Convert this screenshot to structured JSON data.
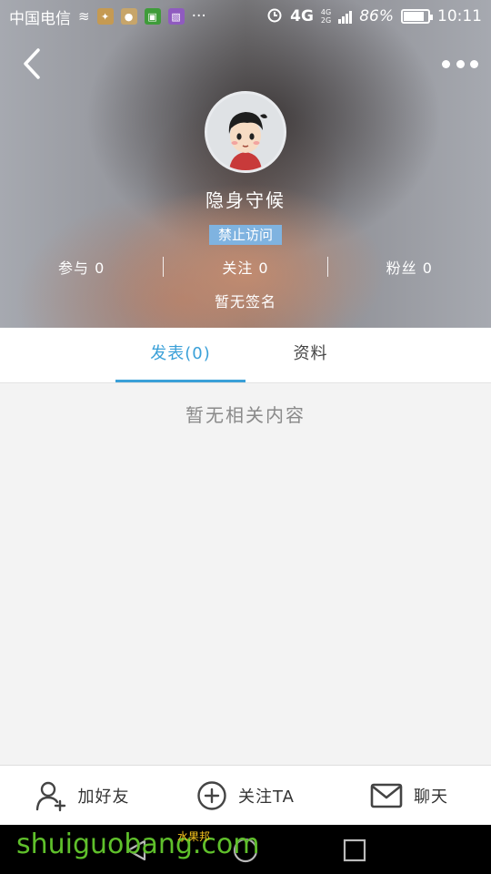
{
  "status_bar": {
    "carrier": "中国电信",
    "battery": "86%",
    "battery_level": 0.86,
    "time": "10:11",
    "network": "4G",
    "network2": "4G",
    "network3": "2G",
    "overflow": "···"
  },
  "profile": {
    "nickname": "隐身守候",
    "ban_label": "禁止访问",
    "signature": "暂无签名"
  },
  "stats": [
    {
      "label": "参与 0"
    },
    {
      "label": "关注 0"
    },
    {
      "label": "粉丝 0"
    }
  ],
  "tabs": [
    {
      "label": "发表(0)",
      "active": true
    },
    {
      "label": "资料",
      "active": false
    }
  ],
  "content": {
    "empty_text": "暂无相关内容"
  },
  "actions": [
    {
      "label": "加好友",
      "icon": "add-user-icon"
    },
    {
      "label": "关注TA",
      "icon": "plus-circle-icon"
    },
    {
      "label": "聊天",
      "icon": "mail-icon"
    }
  ],
  "watermark": {
    "text": "shuiguobang.com",
    "cn": "水果邦"
  },
  "colors": {
    "accent": "#3aa0d8",
    "badge": "#7fb3e0"
  }
}
